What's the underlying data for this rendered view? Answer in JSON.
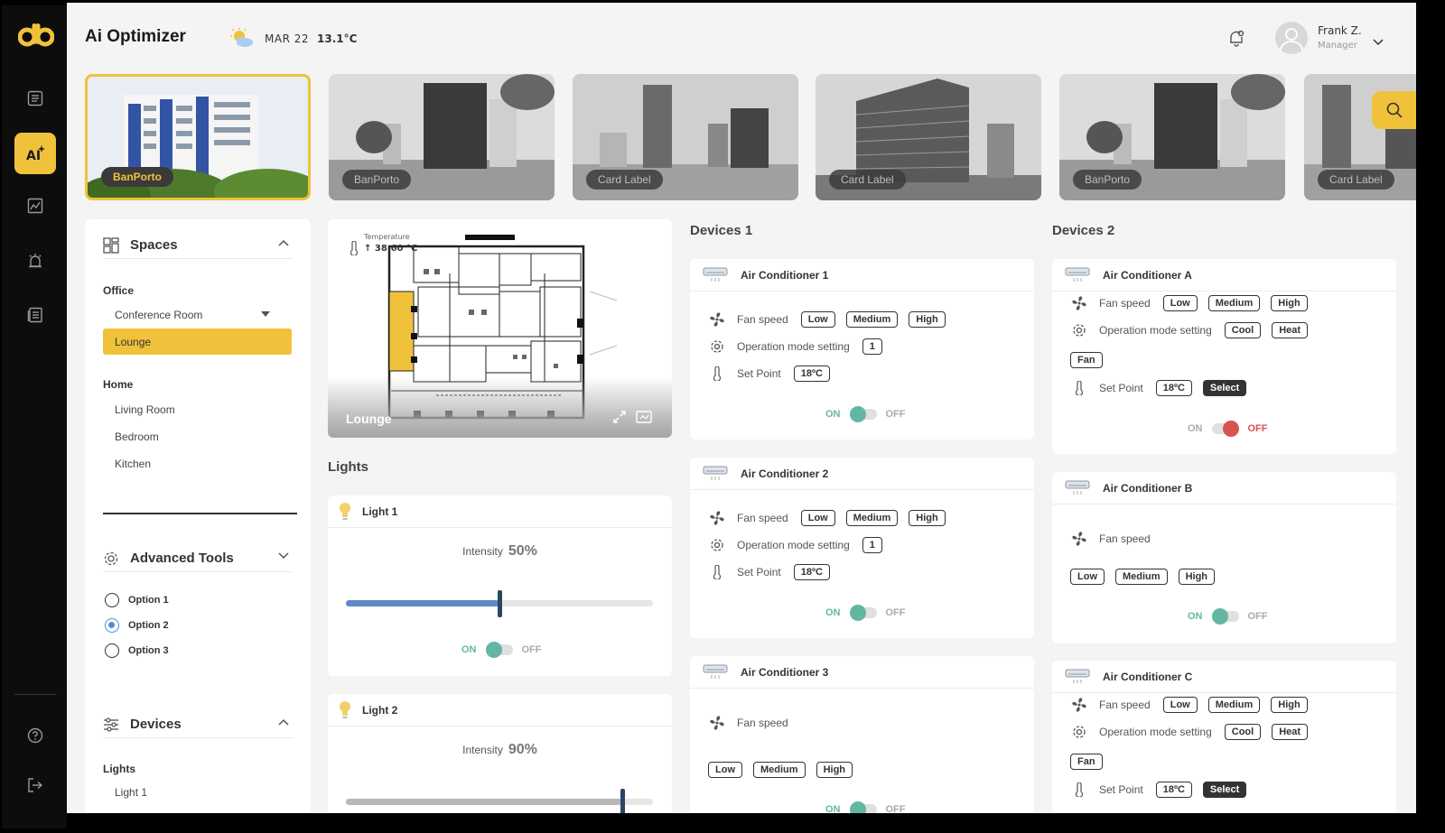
{
  "app": {
    "title": "Ai Optimizer",
    "logo": "db"
  },
  "header": {
    "date": "MAR 22",
    "temperature": "13.1°C",
    "user_name": "Frank Z.",
    "user_role": "Manager"
  },
  "sidebar": {
    "ai_label": "AI"
  },
  "buildings": [
    {
      "label": "BanPorto",
      "active": true
    },
    {
      "label": "BanPorto"
    },
    {
      "label": "Card Label"
    },
    {
      "label": "Card Label"
    },
    {
      "label": "BanPorto"
    },
    {
      "label": "Card Label"
    }
  ],
  "spaces": {
    "title": "Spaces",
    "office_label": "Office",
    "office_items": [
      "Conference Room",
      "Lounge"
    ],
    "home_label": "Home",
    "home_items": [
      "Living Room",
      "Bedroom",
      "Kitchen"
    ]
  },
  "advanced": {
    "title": "Advanced Tools",
    "options": [
      "Option 1",
      "Option 2",
      "Option 3"
    ],
    "selected_option": "Option 2"
  },
  "devices_panel": {
    "title": "Devices",
    "lights_label": "Lights",
    "light_items": [
      "Light 1"
    ]
  },
  "floorplan": {
    "temp_label": "Temperature",
    "temp_value": "↑ 38.60 °C",
    "room": "Lounge"
  },
  "lights": {
    "title": "Lights",
    "items": [
      {
        "name": "Light 1",
        "intensity_label": "Intensity",
        "intensity": "50%",
        "level": 0.5,
        "on": true
      },
      {
        "name": "Light 2",
        "intensity_label": "Intensity",
        "intensity": "90%",
        "level": 0.9,
        "on": true
      }
    ]
  },
  "toggle": {
    "on": "ON",
    "off": "OFF"
  },
  "devices1": {
    "title": "Devices 1",
    "items": [
      {
        "name": "Air Conditioner 1",
        "fan_label": "Fan speed",
        "mode_label": "Operation mode setting",
        "mode_value": "1",
        "setpoint_label": "Set Point",
        "setpoint": "18ºC"
      },
      {
        "name": "Air Conditioner 2",
        "fan_label": "Fan speed",
        "mode_label": "Operation mode setting",
        "mode_value": "1",
        "setpoint_label": "Set Point",
        "setpoint": "18ºC"
      },
      {
        "name": "Air Conditioner 3",
        "fan_label": "Fan speed"
      }
    ]
  },
  "devices2": {
    "title": "Devices 2",
    "items": [
      {
        "name": "Air Conditioner A",
        "fan_label": "Fan speed",
        "mode_label": "Operation mode setting",
        "modes": [
          "Cool",
          "Heat",
          "Fan"
        ],
        "setpoint_label": "Set Point",
        "setpoint": "18ºC",
        "select_label": "Select"
      },
      {
        "name": "Air Conditioner B",
        "fan_label": "Fan speed"
      },
      {
        "name": "Air Conditioner C",
        "fan_label": "Fan speed",
        "mode_label": "Operation mode setting",
        "modes": [
          "Cool",
          "Heat",
          "Fan"
        ],
        "setpoint_label": "Set Point",
        "setpoint": "18ºC",
        "select_label": "Select"
      }
    ]
  },
  "fan_speeds": [
    "Low",
    "Medium",
    "High"
  ],
  "colors": {
    "accent": "#f0c23b",
    "on": "#64b6a3",
    "off": "#d9534f",
    "slider_blue": "#5b8ac6",
    "slider_grey": "#b8b8b8"
  }
}
